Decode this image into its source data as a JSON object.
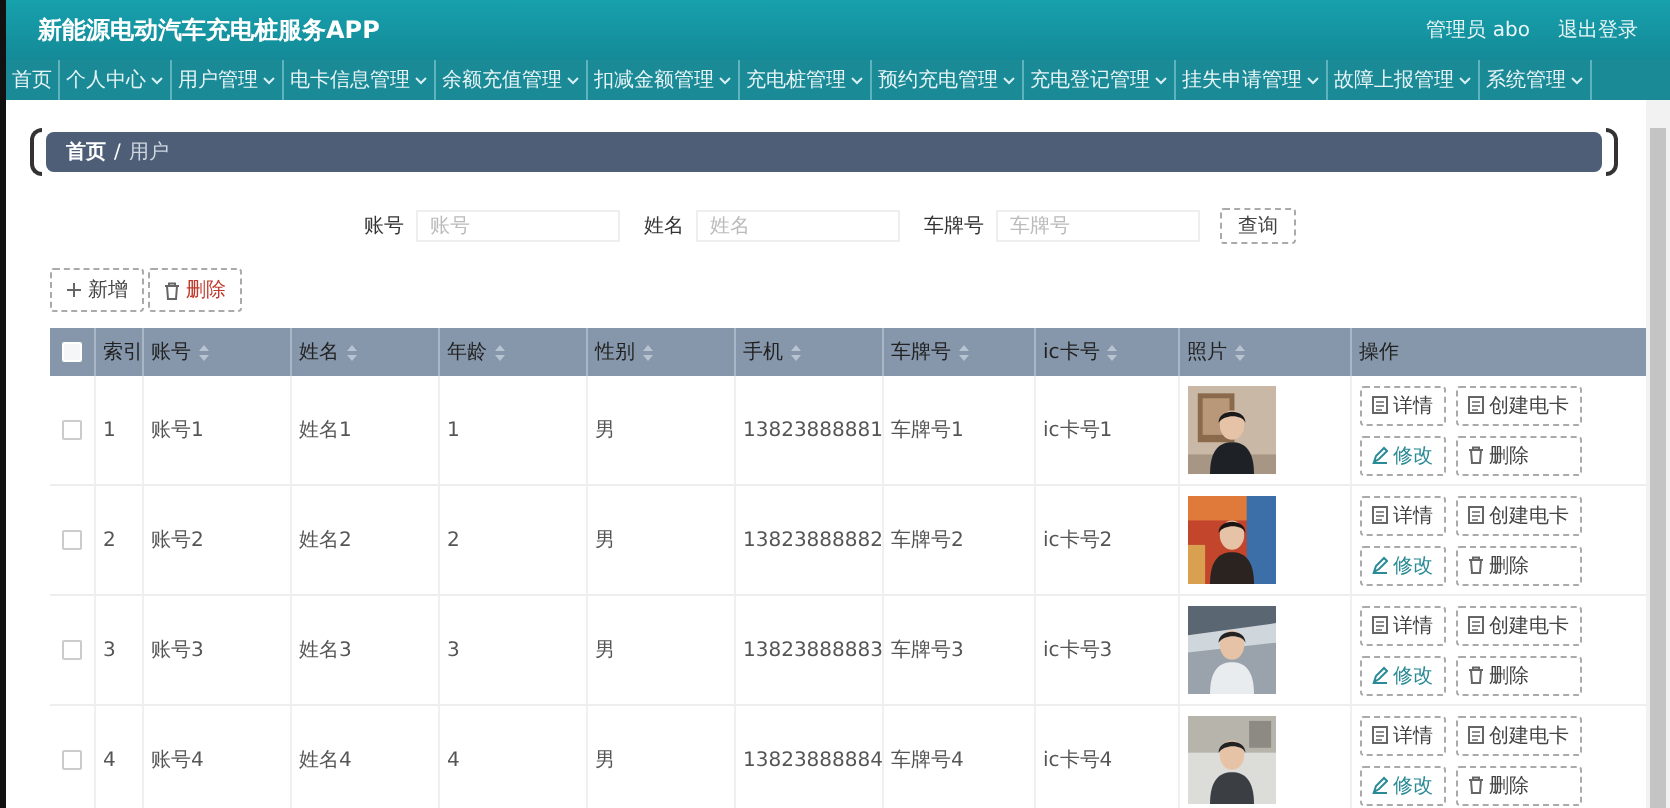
{
  "header": {
    "title": "新能源电动汽车充电桩服务APP",
    "user": "管理员 abo",
    "logout": "退出登录"
  },
  "nav": [
    {
      "label": "首页",
      "dropdown": false
    },
    {
      "label": "个人中心",
      "dropdown": true
    },
    {
      "label": "用户管理",
      "dropdown": true
    },
    {
      "label": "电卡信息管理",
      "dropdown": true
    },
    {
      "label": "余额充值管理",
      "dropdown": true
    },
    {
      "label": "扣减金额管理",
      "dropdown": true
    },
    {
      "label": "充电桩管理",
      "dropdown": true
    },
    {
      "label": "预约充电管理",
      "dropdown": true
    },
    {
      "label": "充电登记管理",
      "dropdown": true
    },
    {
      "label": "挂失申请管理",
      "dropdown": true
    },
    {
      "label": "故障上报管理",
      "dropdown": true
    },
    {
      "label": "系统管理",
      "dropdown": true
    }
  ],
  "breadcrumb": {
    "items": [
      "首页",
      "用户"
    ],
    "separator": "/"
  },
  "search": {
    "fields": [
      {
        "label": "账号",
        "placeholder": "账号"
      },
      {
        "label": "姓名",
        "placeholder": "姓名"
      },
      {
        "label": "车牌号",
        "placeholder": "车牌号"
      }
    ],
    "button": "查询"
  },
  "toolbar": [
    {
      "kind": "add",
      "label": "新增"
    },
    {
      "kind": "delete",
      "label": "删除"
    }
  ],
  "table": {
    "all_checked": false,
    "columns": [
      {
        "label": "索引",
        "sortable": false
      },
      {
        "label": "账号",
        "sortable": true
      },
      {
        "label": "姓名",
        "sortable": true
      },
      {
        "label": "年龄",
        "sortable": true
      },
      {
        "label": "性别",
        "sortable": true
      },
      {
        "label": "手机",
        "sortable": true
      },
      {
        "label": "车牌号",
        "sortable": true
      },
      {
        "label": "ic卡号",
        "sortable": true
      },
      {
        "label": "照片",
        "sortable": true
      },
      {
        "label": "操作",
        "sortable": false
      }
    ],
    "rows": [
      {
        "checked": false,
        "cells": [
          "1",
          "账号1",
          "姓名1",
          "1",
          "男",
          "13823888881",
          "车牌号1",
          "ic卡号1"
        ],
        "actions": [
          {
            "kind": "detail",
            "label": "详情"
          },
          {
            "kind": "card",
            "label": "创建电卡"
          },
          {
            "kind": "edit",
            "label": "修改"
          },
          {
            "kind": "delete",
            "label": "删除"
          }
        ]
      },
      {
        "checked": false,
        "cells": [
          "2",
          "账号2",
          "姓名2",
          "2",
          "男",
          "13823888882",
          "车牌号2",
          "ic卡号2"
        ],
        "actions": [
          {
            "kind": "detail",
            "label": "详情"
          },
          {
            "kind": "card",
            "label": "创建电卡"
          },
          {
            "kind": "edit",
            "label": "修改"
          },
          {
            "kind": "delete",
            "label": "删除"
          }
        ]
      },
      {
        "checked": false,
        "cells": [
          "3",
          "账号3",
          "姓名3",
          "3",
          "男",
          "13823888883",
          "车牌号3",
          "ic卡号3"
        ],
        "actions": [
          {
            "kind": "detail",
            "label": "详情"
          },
          {
            "kind": "card",
            "label": "创建电卡"
          },
          {
            "kind": "edit",
            "label": "修改"
          },
          {
            "kind": "delete",
            "label": "删除"
          }
        ]
      },
      {
        "checked": false,
        "cells": [
          "4",
          "账号4",
          "姓名4",
          "4",
          "男",
          "13823888884",
          "车牌号4",
          "ic卡号4"
        ],
        "actions": [
          {
            "kind": "detail",
            "label": "详情"
          },
          {
            "kind": "card",
            "label": "创建电卡"
          },
          {
            "kind": "edit",
            "label": "修改"
          },
          {
            "kind": "delete",
            "label": "删除"
          }
        ]
      }
    ]
  }
}
